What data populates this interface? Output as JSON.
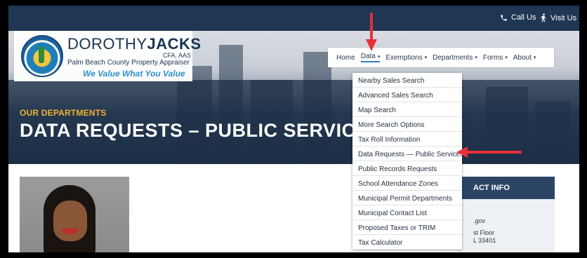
{
  "topbar": {
    "call_label": "Call Us",
    "visit_label": "Visit Us"
  },
  "branding": {
    "name_light": "DOROTHY",
    "name_bold": "JACKS",
    "credentials": "CFA, AAS",
    "office": "Palm Beach County Property Appraiser",
    "tagline": "We Value What You Value",
    "seal_text": "PALM BEACH COUNTY PROPERTY APPRAISER"
  },
  "nav": {
    "items": [
      {
        "label": "Home",
        "has_caret": false
      },
      {
        "label": "Data",
        "has_caret": true
      },
      {
        "label": "Exemptions",
        "has_caret": true
      },
      {
        "label": "Departments",
        "has_caret": true
      },
      {
        "label": "Forms",
        "has_caret": true
      },
      {
        "label": "About",
        "has_caret": true
      }
    ],
    "active": "Data"
  },
  "hero": {
    "eyebrow": "OUR DEPARTMENTS",
    "title": "DATA REQUESTS – PUBLIC SERVICES",
    "title_visible": "DATA REQUESTS – PUBLIC SERVIC"
  },
  "dropdown": {
    "items": [
      "Nearby Sales Search",
      "Advanced Sales Search",
      "Map Search",
      "More Search Options",
      "Tax Roll Information",
      "Data Requests — Public Services",
      "Public Records Requests",
      "School Attendance Zones",
      "Municipal Permit Departments",
      "Municipal Contact List",
      "Proposed Taxes or TRIM",
      "Tax Calculator"
    ],
    "highlighted": "Data Requests — Public Services"
  },
  "contact": {
    "heading_visible": "ACT INFO",
    "line1": ".gov",
    "line2": "st Floor",
    "line3": "L 33401"
  },
  "colors": {
    "topbar": "#1f3754",
    "eyebrow": "#f2b232",
    "tagline": "#2f8fcd",
    "annotation_arrow": "#e8303a",
    "active_underline": "#2f7fc0"
  },
  "icons": {
    "call": "phone-icon",
    "visit": "walking-person-icon",
    "dropdown": "caret-down-icon"
  }
}
